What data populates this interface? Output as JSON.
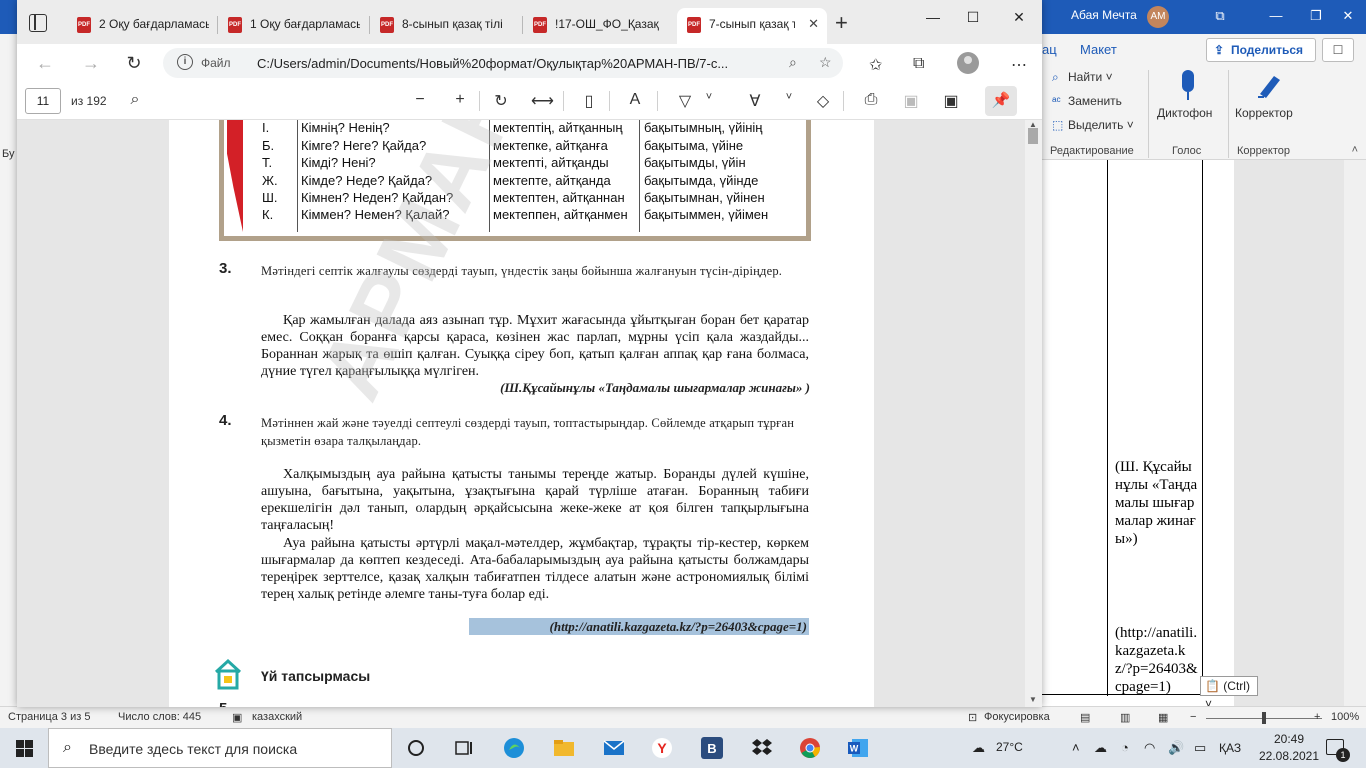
{
  "word": {
    "user_name": "Абая Мечта",
    "avatar_initials": "АМ",
    "tab_partial": "ац",
    "tab_layout": "Макет",
    "share_label": "Поделиться",
    "ribbon": {
      "find": "Найти",
      "replace": "Заменить",
      "select": "Выделить",
      "group_editing": "Редактирование",
      "dictate": "Диктофон",
      "group_voice": "Голос",
      "corrector": "Корректор",
      "group_corrector": "Корректор"
    },
    "left_fragment": "Бу",
    "doc_text_1": "(Ш. Құсайынұлы «Таңдамалы шығармалар жинағы»)",
    "doc_text_2": "(http://anatili.kazgazeta.kz/?p=26403&cpage=1)",
    "paste_options": "(Ctrl)",
    "status": {
      "page": "Страница 3 из 5",
      "words": "Число слов: 445",
      "language": "казахский",
      "focus": "Фокусировка",
      "zoom": "100%"
    }
  },
  "edge": {
    "tabs": [
      {
        "title": "2 Оқу бағдарламасы"
      },
      {
        "title": "1 Оқу бағдарламасы"
      },
      {
        "title": "8-сынып қазақ тілі"
      },
      {
        "title": "!17-ОШ_ФО_Қазақ"
      },
      {
        "title": "7-сынып қазақ тілі",
        "active": true
      }
    ],
    "address_label": "Файл",
    "url": "C:/Users/admin/Documents/Новый%20формат/Оқулықтар%20АРМАН-ПВ/7-с...",
    "pdf": {
      "page_num": "11",
      "page_of": "из 192"
    }
  },
  "textbook": {
    "cases": [
      {
        "case": "І.",
        "q": "Кімнің? Ненің?",
        "ex1": "мектептің, айтқанның",
        "ex2": "бақытымның, үйінің"
      },
      {
        "case": "Б.",
        "q": "Кімге? Неге? Қайда?",
        "ex1": "мектепке, айтқанға",
        "ex2": "бақытыма, үйіне"
      },
      {
        "case": "Т.",
        "q": "Кімді? Нені?",
        "ex1": "мектепті, айтқанды",
        "ex2": "бақытымды, үйін"
      },
      {
        "case": "Ж.",
        "q": "Кімде? Неде? Қайда?",
        "ex1": "мектепте, айтқанда",
        "ex2": "бақытымда, үйінде"
      },
      {
        "case": "Ш.",
        "q": "Кімнен? Неден? Қайдан?",
        "ex1": "мектептен, айтқаннан",
        "ex2": "бақытымнан, үйінен"
      },
      {
        "case": "К.",
        "q": "Кіммен? Немен? Қалай?",
        "ex1": "мектеппен, айтқанмен",
        "ex2": "бақытыммен, үйімен"
      }
    ],
    "ex3_num": "3.",
    "ex3_task": "Мәтіндегі септік жалғаулы сөздерді тауып, үндестік заңы бойынша жалғануын түсін-діріңдер.",
    "ex3_text": "Қар жамылған далада аяз азынап тұр. Мұхит жағасында ұйытқыған боран бет қаратар емес. Соққан боранға қарсы қараса, көзінен жас парлап, мұрны үсіп қала жаздайды... Бораннан жарық та өшіп қалған. Суыққа сіреу боп, қатып қалған аппақ қар ғана болмаса, дүние түгел қараңғылыққа мүлгіген.",
    "ex3_cite": "(Ш.Құсайынұлы «Таңдамалы шығармалар жинағы» )",
    "ex4_num": "4.",
    "ex4_task": "Мәтіннен жай және тәуелді септеулі сөздерді тауып, топтастырыңдар. Сөйлемде атқарып тұрған қызметін өзара талқылаңдар.",
    "ex4_p1": "Халқымыздың ауа райына қатысты танымы тереңде жатыр. Боранды дүлей күшіне, ашуына, бағытына, уақытына, ұзақтығына қарай түрліше атаған. Боранның табиғи ерекшелігін дәл танып, олардың әрқайсысына жеке-жеке ат қоя білген тапқырлығына таңғаласың!",
    "ex4_p2": "Ауа райына қатысты әртүрлі мақал-мәтелдер, жұмбақтар, тұрақты тір-кестер, көркем шығармалар да көптеп кездеседі. Ата-бабаларымыздың ауа райына қатысты болжамдары тереңірек зерттелсе, қазақ халқын табиғатпен тілдесе алатын және астрономиялық білімі терең халық ретінде әлемге таны-туға болар еді.",
    "ex4_src": "(http://anatili.kazgazeta.kz/?p=26403&cpage=1)",
    "homework_title": "Үй тапсырмасы",
    "next_num": "5."
  },
  "taskbar": {
    "search_placeholder": "Введите здесь текст для поиска",
    "temperature": "27°C",
    "language": "ҚАЗ",
    "time": "20:49",
    "date": "22.08.2021",
    "notifications": "1"
  }
}
